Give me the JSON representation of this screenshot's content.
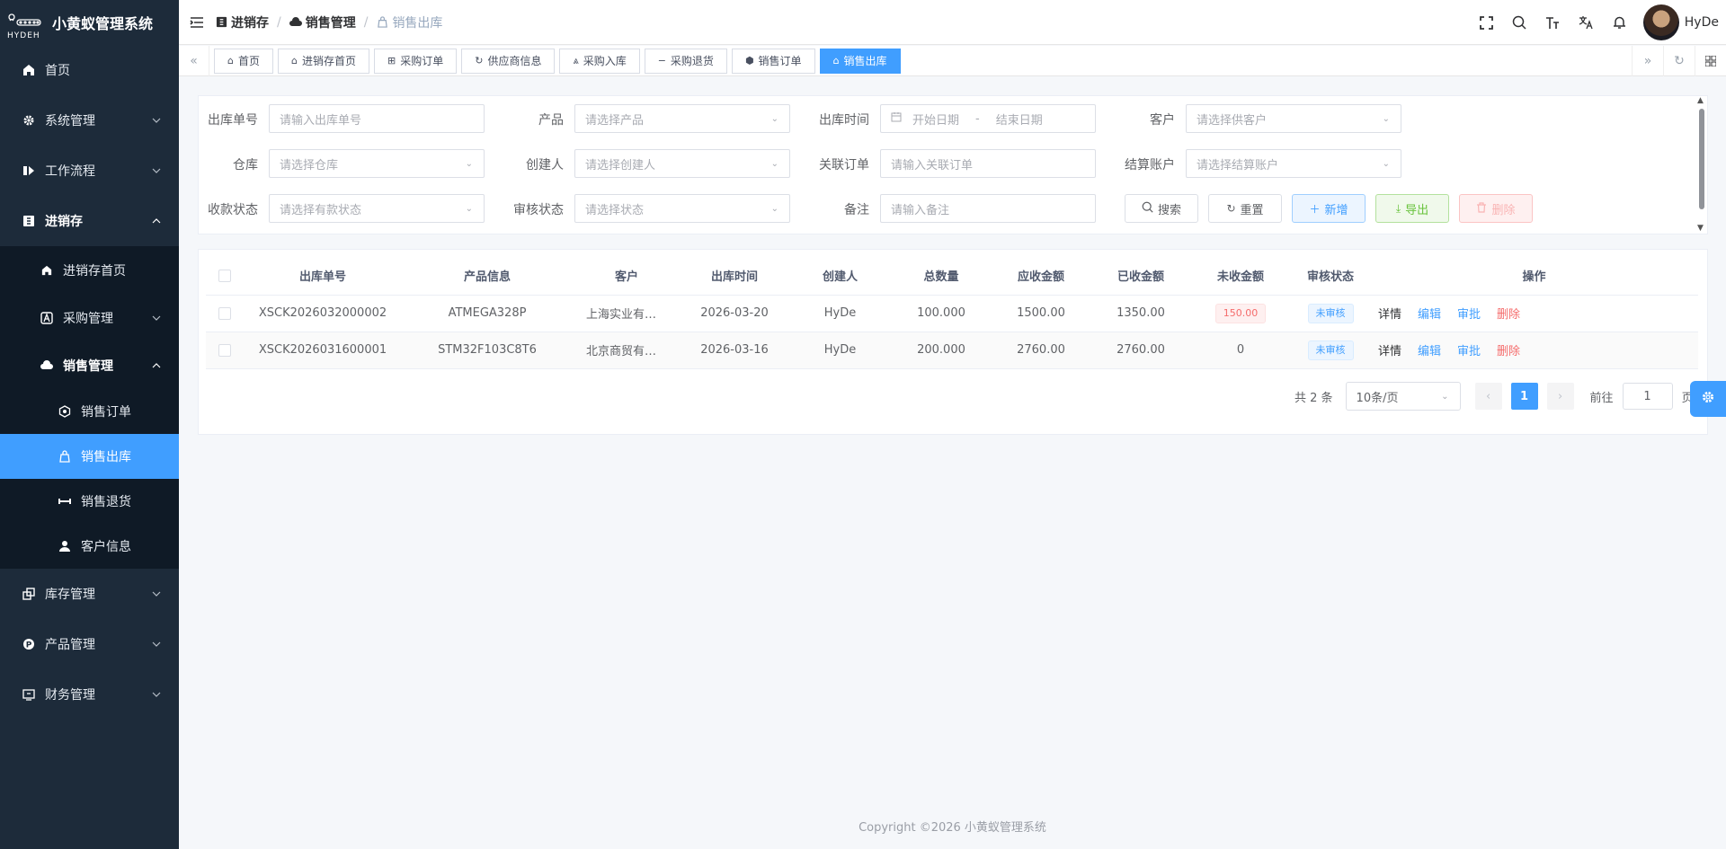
{
  "app": {
    "title": "小黄蚁管理系统",
    "logo_text": "HYDEH"
  },
  "sidebar": {
    "items": [
      {
        "label": "首页",
        "icon": "home-icon"
      },
      {
        "label": "系统管理",
        "icon": "gear-icon"
      },
      {
        "label": "工作流程",
        "icon": "workflow-icon"
      },
      {
        "label": "进销存",
        "icon": "inventory-icon"
      }
    ],
    "jxc_sub": [
      {
        "label": "进销存首页"
      },
      {
        "label": "采购管理"
      },
      {
        "label": "销售管理"
      }
    ],
    "sales_sub": [
      {
        "label": "销售订单"
      },
      {
        "label": "销售出库"
      },
      {
        "label": "销售退货"
      },
      {
        "label": "客户信息"
      }
    ],
    "after": [
      {
        "label": "库存管理"
      },
      {
        "label": "产品管理"
      },
      {
        "label": "财务管理"
      }
    ]
  },
  "header": {
    "breadcrumb": [
      "进销存",
      "销售管理",
      "销售出库"
    ],
    "username": "HyDe"
  },
  "tabs": [
    {
      "label": "首页"
    },
    {
      "label": "进销存首页"
    },
    {
      "label": "采购订单"
    },
    {
      "label": "供应商信息"
    },
    {
      "label": "采购入库"
    },
    {
      "label": "采购退货"
    },
    {
      "label": "销售订单"
    },
    {
      "label": "销售出库"
    }
  ],
  "filter": {
    "labels": {
      "order_no": "出库单号",
      "product": "产品",
      "time": "出库时间",
      "customer": "客户",
      "warehouse": "仓库",
      "creator": "创建人",
      "related": "关联订单",
      "account": "结算账户",
      "payment": "收款状态",
      "audit": "审核状态",
      "remark": "备注"
    },
    "placeholders": {
      "order_no": "请输入出库单号",
      "product": "请选择产品",
      "start": "开始日期",
      "end": "结束日期",
      "customer": "请选择供客户",
      "warehouse": "请选择仓库",
      "creator": "请选择创建人",
      "related": "请输入关联订单",
      "account": "请选择结算账户",
      "payment": "请选择有款状态",
      "audit": "请选择状态",
      "remark": "请输入备注"
    },
    "date_sep": "-",
    "buttons": {
      "search": "搜索",
      "reset": "重置",
      "add": "新增",
      "export": "导出",
      "delete": "删除"
    }
  },
  "table": {
    "headers": [
      "出库单号",
      "产品信息",
      "客户",
      "出库时间",
      "创建人",
      "总数量",
      "应收金额",
      "已收金额",
      "未收金额",
      "审核状态",
      "操作"
    ],
    "rows": [
      {
        "no": "XSCK2026032000002",
        "product": "ATMEGA328P",
        "customer": "上海实业有限公司",
        "time": "2026-03-20",
        "creator": "HyDe",
        "qty": "100.000",
        "receivable": "1500.00",
        "received": "1350.00",
        "unpaid": "150.00",
        "status": "未审核"
      },
      {
        "no": "XSCK2026031600001",
        "product": "STM32F103C8T6",
        "customer": "北京商贸有限公司",
        "time": "2026-03-16",
        "creator": "HyDe",
        "qty": "200.000",
        "receivable": "2760.00",
        "received": "2760.00",
        "unpaid": "0",
        "status": "未审核"
      }
    ],
    "ops": {
      "detail": "详情",
      "edit": "编辑",
      "approve": "审批",
      "delete": "删除"
    }
  },
  "pagination": {
    "total": "共 2 条",
    "size": "10条/页",
    "current": "1",
    "goto_label": "前往",
    "goto_value": "1",
    "suffix": "页"
  },
  "footer": "Copyright ©2026 小黄蚁管理系统",
  "colors": {
    "primary": "#409eff",
    "sidebar": "#1d2b3a",
    "danger": "#f56c6c",
    "success": "#67c23a"
  }
}
